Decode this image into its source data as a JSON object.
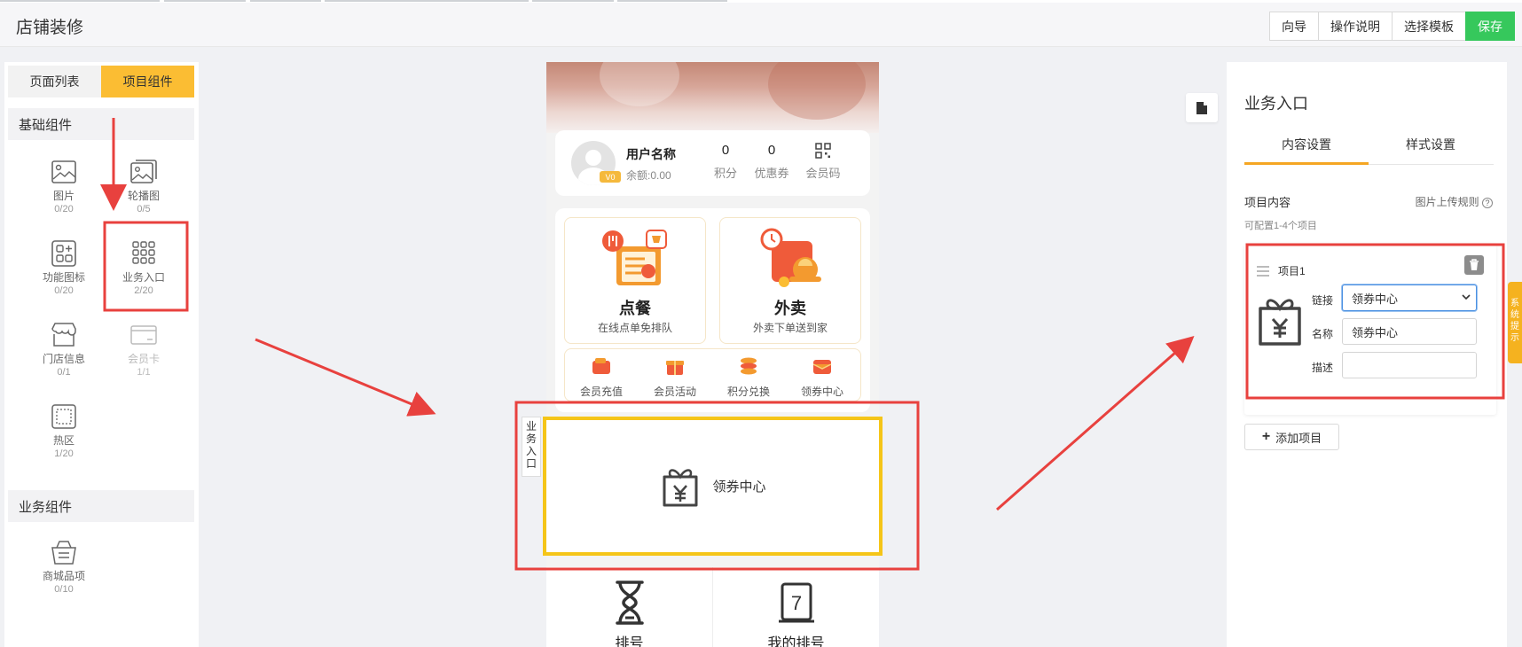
{
  "header": {
    "title": "店铺装修",
    "buttons": {
      "guide": "向导",
      "help": "操作说明",
      "template": "选择模板",
      "save": "保存"
    }
  },
  "left_panel": {
    "tabs": {
      "pages": "页面列表",
      "components": "项目组件"
    },
    "basic_section": "基础组件",
    "business_section": "业务组件",
    "components": [
      {
        "name": "图片",
        "count": "0/20",
        "icon": "image-icon"
      },
      {
        "name": "轮播图",
        "count": "0/5",
        "icon": "carousel-icon"
      },
      {
        "name": "功能图标",
        "count": "0/20",
        "icon": "function-icons-icon"
      },
      {
        "name": "业务入口",
        "count": "2/20",
        "icon": "grid-icon"
      },
      {
        "name": "门店信息",
        "count": "0/1",
        "icon": "store-icon"
      },
      {
        "name": "会员卡",
        "count": "1/1",
        "icon": "card-icon"
      },
      {
        "name": "热区",
        "count": "1/20",
        "icon": "hotzone-icon"
      }
    ],
    "business_components": [
      {
        "name": "商城品项",
        "count": "0/10",
        "icon": "basket-icon"
      }
    ]
  },
  "phone": {
    "user": {
      "name": "用户名称",
      "balance": "余额:0.00",
      "badge": "V0"
    },
    "stats": [
      {
        "value": "0",
        "label": "积分"
      },
      {
        "value": "0",
        "label": "优惠券"
      },
      {
        "value": "",
        "label": "会员码"
      }
    ],
    "big_entries": [
      {
        "title": "点餐",
        "subtitle": "在线点单免排队"
      },
      {
        "title": "外卖",
        "subtitle": "外卖下单送到家"
      }
    ],
    "mini_entries": [
      "会员充值",
      "会员活动",
      "积分兑换",
      "领券中心"
    ],
    "selected_block": {
      "side_label": "业务入口",
      "text": "领券中心"
    },
    "bottom_entries": [
      "排号",
      "我的排号"
    ]
  },
  "right_panel": {
    "title": "业务入口",
    "tabs": {
      "content": "内容设置",
      "style": "样式设置"
    },
    "content_label": "项目内容",
    "upload_rule": "图片上传规则",
    "hint": "可配置1-4个项目",
    "item": {
      "title": "项目1",
      "link_label": "链接",
      "link_value": "领券中心",
      "name_label": "名称",
      "name_value": "领券中心",
      "desc_label": "描述",
      "desc_value": ""
    },
    "add_button": "添加项目"
  },
  "system_note": "系统提示",
  "colors": {
    "accent": "#fbbd33",
    "save": "#36c85c",
    "annotation": "#e8413e",
    "selection": "#f5c518"
  }
}
